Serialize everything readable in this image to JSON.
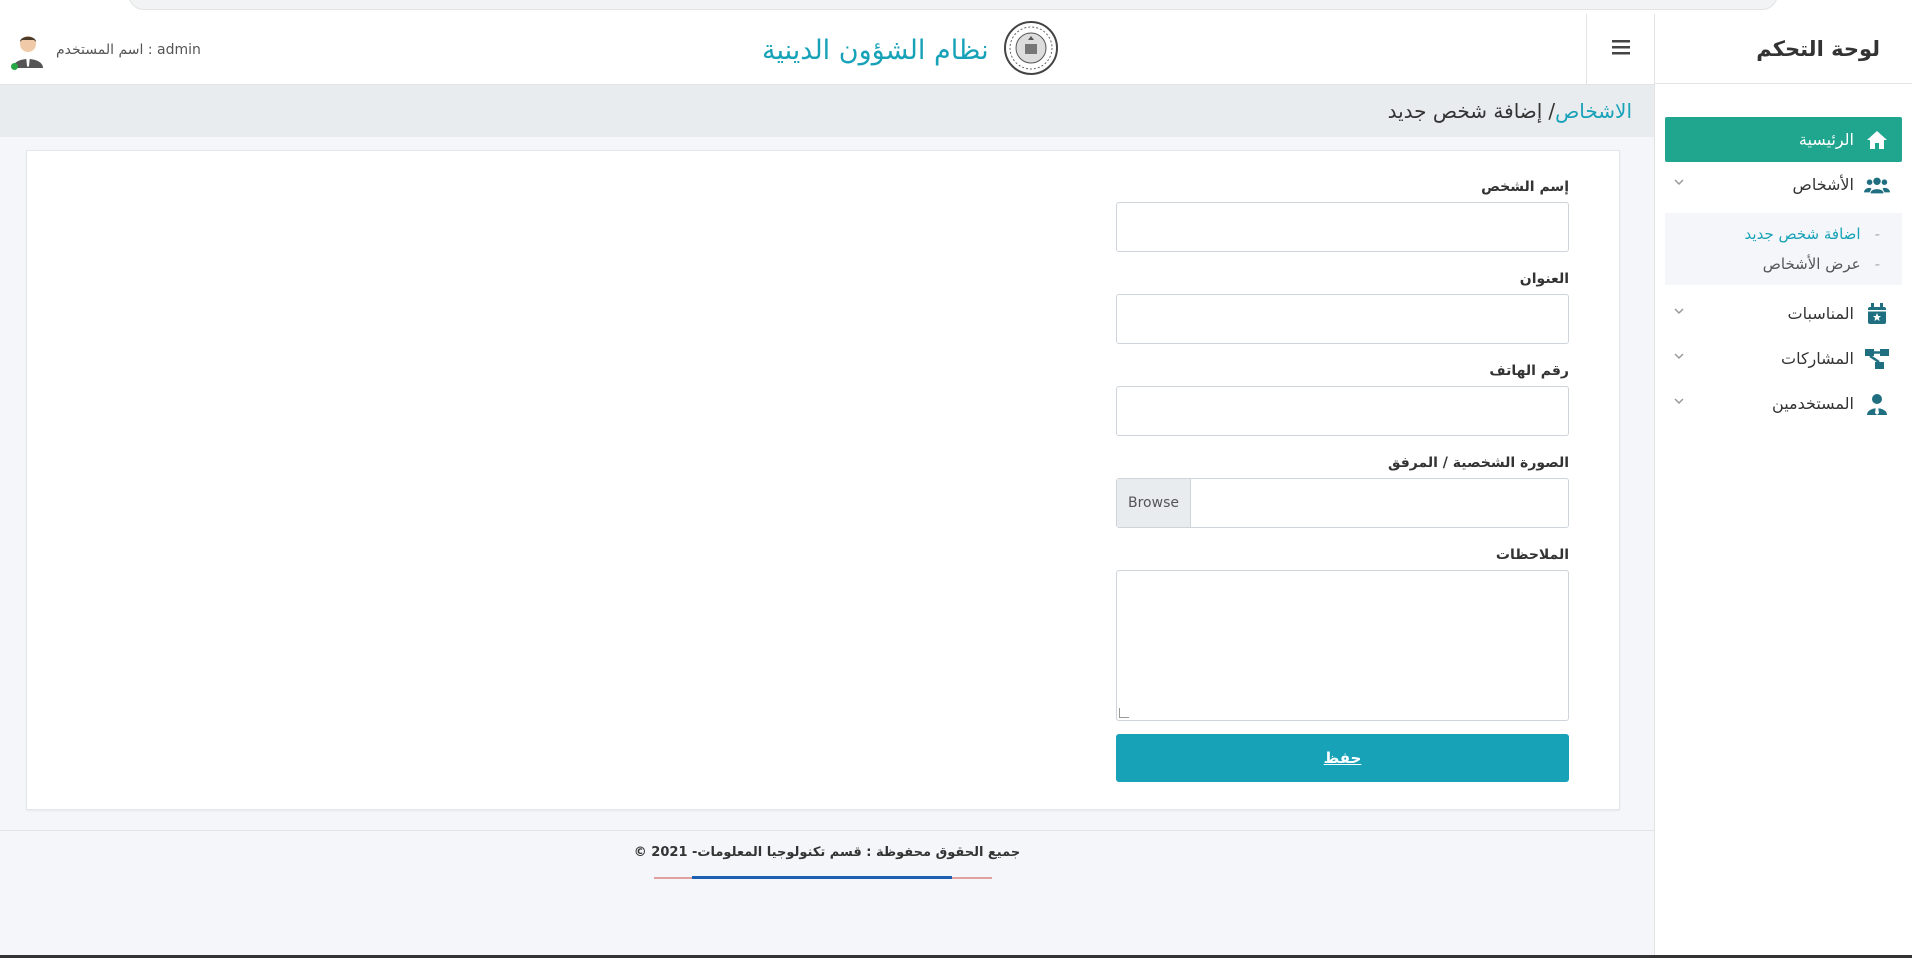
{
  "sidebar": {
    "brand": "لوحة التحكم",
    "items": [
      {
        "label": "الرئيسية",
        "icon": "home-icon",
        "active": true
      },
      {
        "label": "الأشخاص",
        "icon": "users-icon",
        "submenu": [
          {
            "label": "اضافة شخص جديد",
            "current": true
          },
          {
            "label": "عرض الأشخاص"
          }
        ]
      },
      {
        "label": "المناسبات",
        "icon": "calendar-star-icon"
      },
      {
        "label": "المشاركات",
        "icon": "sitemap-icon"
      },
      {
        "label": "المستخدمين",
        "icon": "user-tie-icon"
      }
    ]
  },
  "header": {
    "site_title": "نظام الشؤون الدينية",
    "username": "اسم المستخدم : admin",
    "menu_icon": "hamburger-icon"
  },
  "breadcrumb": {
    "parent": "الاشخاص",
    "separator": "/",
    "current": "إضافة شخص جديد"
  },
  "form": {
    "name_label": "إسم الشخص",
    "address_label": "العنوان",
    "phone_label": "رقم الهاتف",
    "photo_label": "الصورة الشخصية / المرفق",
    "browse_label": "Browse",
    "notes_label": "الملاحظات",
    "save_label": "حفظ"
  },
  "footer": {
    "copyright": "© 2021 -جميع الحقوق محفوظة : قسم تكنولوجيا المعلومات"
  },
  "colors": {
    "accent": "#17a2b8",
    "active_nav": "#20a58f",
    "online": "#28a745"
  }
}
